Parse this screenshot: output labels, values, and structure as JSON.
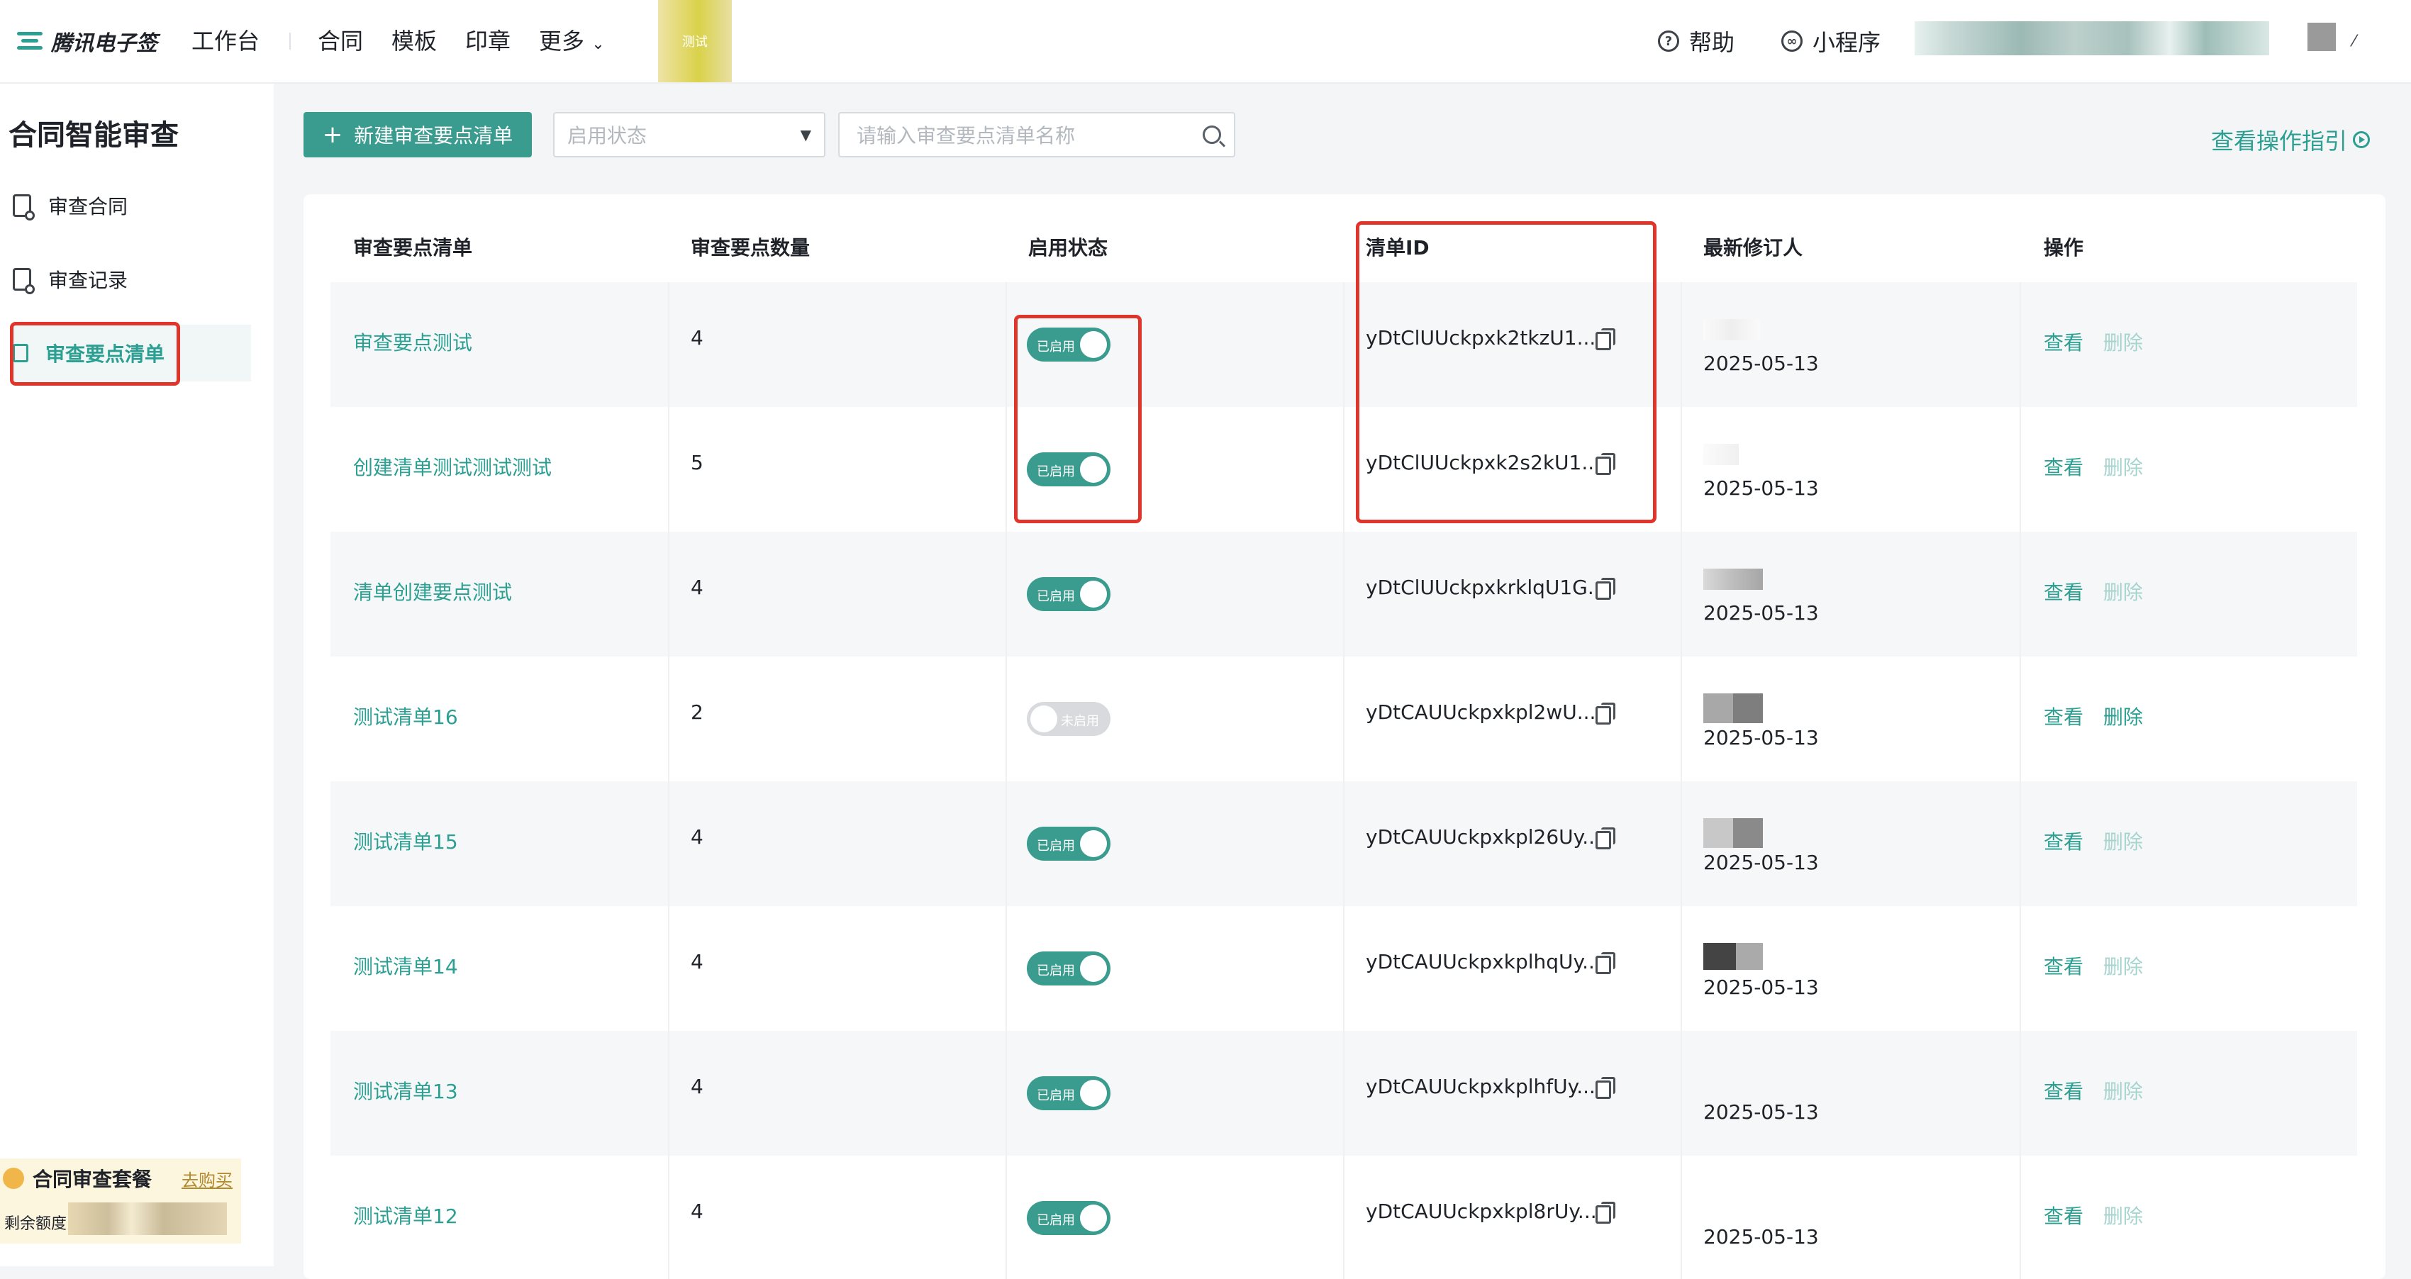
{
  "header": {
    "logo_text": "腾讯电子签",
    "nav": [
      "工作台",
      "合同",
      "模板",
      "印章",
      "更多"
    ],
    "test_tag": "测试",
    "help_label": "帮助",
    "miniprogram_label": "小程序",
    "more_icon": "chevron-down-icon"
  },
  "sidebar": {
    "title": "合同智能审查",
    "items": [
      {
        "label": "审查合同",
        "icon": "document-icon",
        "active": false
      },
      {
        "label": "审查记录",
        "icon": "document-icon",
        "active": false
      },
      {
        "label": "审查要点清单",
        "icon": "list-icon",
        "active": true
      }
    ],
    "promo": {
      "title": "合同审查套餐",
      "link": "去购买",
      "quota_label": "剩余额度"
    }
  },
  "toolbar": {
    "new_button": "新建审查要点清单",
    "new_button_icon": "+",
    "status_placeholder": "启用状态",
    "search_placeholder": "请输入审查要点清单名称",
    "guide_link": "查看操作指引"
  },
  "table": {
    "headers": [
      "审查要点清单",
      "审查要点数量",
      "启用状态",
      "清单ID",
      "最新修订人",
      "操作"
    ],
    "rows": [
      {
        "name": "审查要点测试",
        "count": "4",
        "status": "已启用",
        "enabled": true,
        "id": "yDtClUUckpxk2tkzU1...",
        "date": "2025-05-13",
        "view": "查看",
        "delete": "删除",
        "delete_enabled": false
      },
      {
        "name": "创建清单测试测试测试",
        "count": "5",
        "status": "已启用",
        "enabled": true,
        "id": "yDtClUUckpxk2s2kU1...",
        "date": "2025-05-13",
        "view": "查看",
        "delete": "删除",
        "delete_enabled": false
      },
      {
        "name": "清单创建要点测试",
        "count": "4",
        "status": "已启用",
        "enabled": true,
        "id": "yDtClUUckpxkrklqU1G...",
        "date": "2025-05-13",
        "view": "查看",
        "delete": "删除",
        "delete_enabled": false
      },
      {
        "name": "测试清单16",
        "count": "2",
        "status": "未启用",
        "enabled": false,
        "id": "yDtCAUUckpxkpl2wU...",
        "date": "2025-05-13",
        "view": "查看",
        "delete": "删除",
        "delete_enabled": true
      },
      {
        "name": "测试清单15",
        "count": "4",
        "status": "已启用",
        "enabled": true,
        "id": "yDtCAUUckpxkpl26Uy...",
        "date": "2025-05-13",
        "view": "查看",
        "delete": "删除",
        "delete_enabled": false
      },
      {
        "name": "测试清单14",
        "count": "4",
        "status": "已启用",
        "enabled": true,
        "id": "yDtCAUUckpxkplhqUy...",
        "date": "2025-05-13",
        "view": "查看",
        "delete": "删除",
        "delete_enabled": false
      },
      {
        "name": "测试清单13",
        "count": "4",
        "status": "已启用",
        "enabled": true,
        "id": "yDtCAUUckpxkplhfUy...",
        "date": "2025-05-13",
        "view": "查看",
        "delete": "删除",
        "delete_enabled": false
      },
      {
        "name": "测试清单12",
        "count": "4",
        "status": "已启用",
        "enabled": true,
        "id": "yDtCAUUckpxkpl8rUy...",
        "date": "2025-05-13",
        "view": "查看",
        "delete": "删除",
        "delete_enabled": false
      }
    ]
  },
  "colors": {
    "accent": "#2a9f92",
    "highlight_box": "#e0352b"
  }
}
